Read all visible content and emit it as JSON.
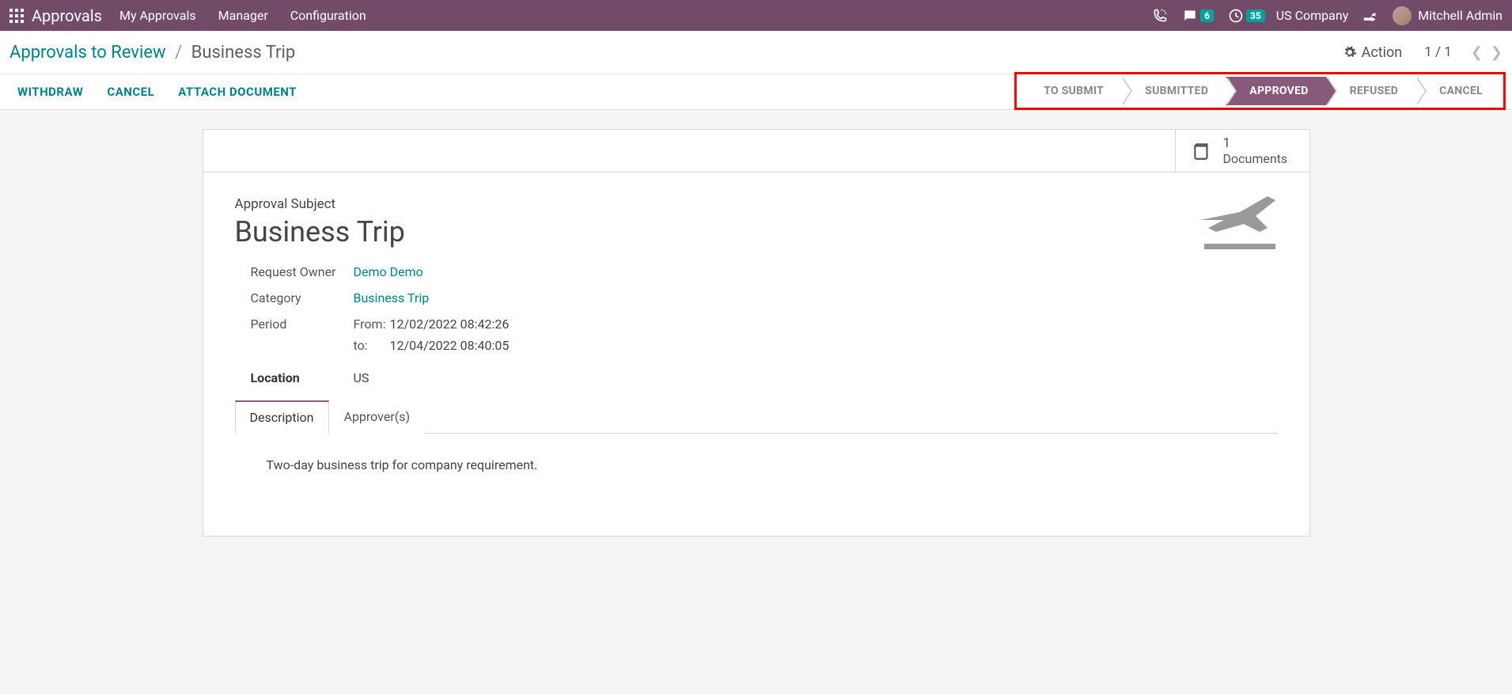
{
  "topnav": {
    "brand": "Approvals",
    "menu": [
      "My Approvals",
      "Manager",
      "Configuration"
    ],
    "chat_badge": "6",
    "clock_badge": "35",
    "company": "US Company",
    "user": "Mitchell Admin"
  },
  "breadcrumb": {
    "link": "Approvals to Review",
    "current": "Business Trip"
  },
  "action_menu_label": "Action",
  "pager": {
    "text": "1 / 1"
  },
  "actions": {
    "withdraw": "WITHDRAW",
    "cancel": "CANCEL",
    "attach": "ATTACH DOCUMENT"
  },
  "statusbar": {
    "steps": [
      "TO SUBMIT",
      "SUBMITTED",
      "APPROVED",
      "REFUSED",
      "CANCEL"
    ],
    "active_index": 2
  },
  "documents": {
    "count": "1",
    "label": "Documents"
  },
  "form": {
    "subject_label": "Approval Subject",
    "subject": "Business Trip",
    "owner_label": "Request Owner",
    "owner": "Demo Demo",
    "category_label": "Category",
    "category": "Business Trip",
    "period_label": "Period",
    "period_from_label": "From:",
    "period_from": "12/02/2022 08:42:26",
    "period_to_label": "to:",
    "period_to": "12/04/2022 08:40:05",
    "location_label": "Location",
    "location": "US"
  },
  "tabs": {
    "description": "Description",
    "approvers": "Approver(s)"
  },
  "description_text": "Two-day business trip for company requirement."
}
